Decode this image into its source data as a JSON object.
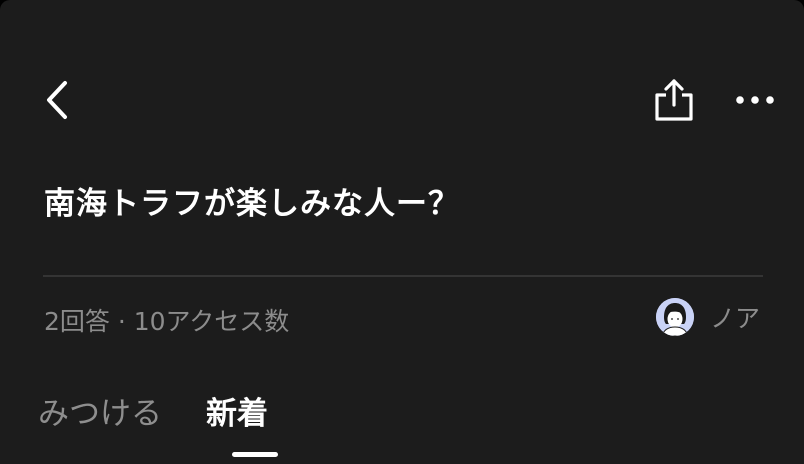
{
  "header": {
    "back_icon": "chevron-left-icon",
    "share_icon": "share-icon",
    "more_icon": "more-horizontal-icon"
  },
  "question": {
    "title": "南海トラフが楽しみな人ー？",
    "stats": "2回答 · 10アクセス数",
    "author": {
      "name": "ノア",
      "avatar_icon": "user-avatar-icon"
    }
  },
  "tabs": [
    {
      "label": "みつける",
      "selected": false
    },
    {
      "label": "新着",
      "selected": true
    }
  ],
  "colors": {
    "background": "#1c1c1c",
    "text_primary": "#ffffff",
    "text_secondary": "#8c8c8c",
    "avatar_bg": "#c9d2f6"
  }
}
